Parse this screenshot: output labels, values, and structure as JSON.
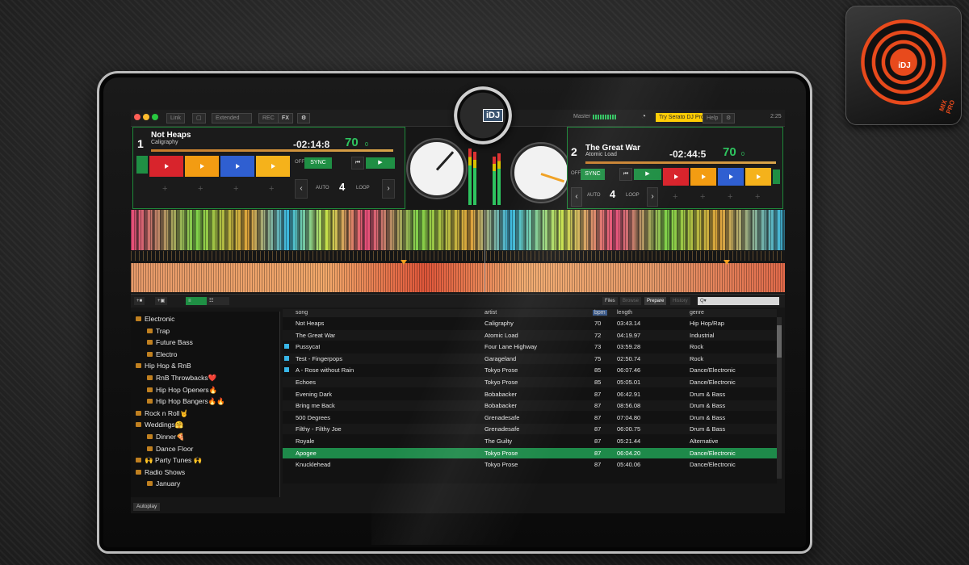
{
  "app": {
    "logo_text": "iDJ",
    "logo_subtext": "MIX PRO",
    "cam_badge_text": "iDJ"
  },
  "topbar": {
    "link": "Link",
    "layout": "Extended",
    "rec": "REC",
    "fx": "FX",
    "master": "Master",
    "try_pro": "Try Serato DJ Pro",
    "help": "Help",
    "clock": "2:25"
  },
  "deck1": {
    "number": "1",
    "title": "Not Heaps",
    "artist": "Caligraphy",
    "time": "-02:14:8",
    "bpm": "70",
    "bpm_decimal": "0",
    "sync": "SYNC",
    "off": "OFF",
    "auto": "AUTO",
    "loop_count": "4",
    "loop": "LOOP",
    "pad_colors": [
      "#d8242c",
      "#f39c12",
      "#2f5fd1",
      "#f5b21b"
    ]
  },
  "deck2": {
    "number": "2",
    "title": "The Great War",
    "artist": "Atomic Load",
    "time": "-02:44:5",
    "bpm": "70",
    "bpm_decimal": "0",
    "sync": "SYNC",
    "off": "OFF",
    "auto": "AUTO",
    "loop_count": "4",
    "loop": "LOOP",
    "pad_colors": [
      "#d8242c",
      "#f39c12",
      "#2f5fd1",
      "#f5b21b"
    ]
  },
  "library": {
    "tabs": [
      "Files",
      "Browse",
      "Prepare",
      "History"
    ],
    "search_placeholder": "Q▾",
    "autoplay": "Autoplay",
    "columns": [
      "song",
      "artist",
      "bpm",
      "length",
      "genre"
    ],
    "crates": [
      {
        "label": "Electronic",
        "level": 0
      },
      {
        "label": "Trap",
        "level": 1
      },
      {
        "label": "Future Bass",
        "level": 1
      },
      {
        "label": "Electro",
        "level": 1
      },
      {
        "label": "Hip Hop & RnB",
        "level": 0
      },
      {
        "label": "RnB Throwbacks❤️",
        "level": 1
      },
      {
        "label": "Hip Hop Openers🔥",
        "level": 1
      },
      {
        "label": "Hip Hop Bangers🔥🔥",
        "level": 1
      },
      {
        "label": "Rock n Roll🤘",
        "level": 0
      },
      {
        "label": "Weddings🤗",
        "level": 0
      },
      {
        "label": "Dinner🍕",
        "level": 1
      },
      {
        "label": "Dance Floor",
        "level": 1
      },
      {
        "label": "🙌 Party Tunes 🙌",
        "level": 0
      },
      {
        "label": "Radio Shows",
        "level": 0
      },
      {
        "label": "January",
        "level": 1
      }
    ],
    "tracks": [
      {
        "song": "Not Heaps",
        "artist": "Caligraphy",
        "bpm": "70",
        "length": "03:43.14",
        "genre": "Hip Hop/Rap",
        "marked": false
      },
      {
        "song": "The Great War",
        "artist": "Atomic Load",
        "bpm": "72",
        "length": "04:19.97",
        "genre": "Industrial",
        "marked": false
      },
      {
        "song": "Pussycat",
        "artist": "Four Lane Highway",
        "bpm": "73",
        "length": "03:59.28",
        "genre": "Rock",
        "marked": true
      },
      {
        "song": "Test - Fingerpops",
        "artist": "Garageland",
        "bpm": "75",
        "length": "02:50.74",
        "genre": "Rock",
        "marked": true
      },
      {
        "song": "A - Rose without Rain",
        "artist": "Tokyo Prose",
        "bpm": "85",
        "length": "06:07.46",
        "genre": "Dance/Electronic",
        "marked": true
      },
      {
        "song": "Echoes",
        "artist": "Tokyo Prose",
        "bpm": "85",
        "length": "05:05.01",
        "genre": "Dance/Electronic",
        "marked": false
      },
      {
        "song": "Evening Dark",
        "artist": "Bobabacker",
        "bpm": "87",
        "length": "06:42.91",
        "genre": "Drum & Bass",
        "marked": false
      },
      {
        "song": "Bring me Back",
        "artist": "Bobabacker",
        "bpm": "87",
        "length": "08:56.08",
        "genre": "Drum & Bass",
        "marked": false
      },
      {
        "song": "500 Degrees",
        "artist": "Grenadesafe",
        "bpm": "87",
        "length": "07:04.80",
        "genre": "Drum & Bass",
        "marked": false
      },
      {
        "song": "Filthy - Filthy Joe",
        "artist": "Grenadesafe",
        "bpm": "87",
        "length": "06:00.75",
        "genre": "Drum & Bass",
        "marked": false
      },
      {
        "song": "Royale",
        "artist": "The Guilty",
        "bpm": "87",
        "length": "05:21.44",
        "genre": "Alternative",
        "marked": false
      },
      {
        "song": "Apogee",
        "artist": "Tokyo Prose",
        "bpm": "87",
        "length": "06:04.20",
        "genre": "Dance/Electronic",
        "marked": false,
        "selected": true
      },
      {
        "song": "Knucklehead",
        "artist": "Tokyo Prose",
        "bpm": "87",
        "length": "05:40.06",
        "genre": "Dance/Electronic",
        "marked": false
      }
    ]
  }
}
